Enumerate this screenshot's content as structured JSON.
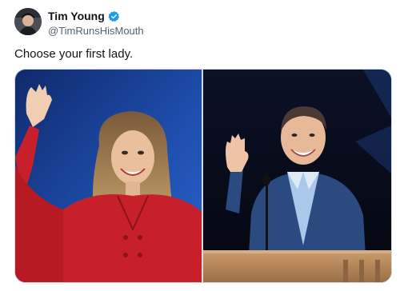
{
  "user": {
    "display_name": "Tim Young",
    "handle": "@TimRunsHisMouth",
    "verified": true,
    "avatar_icon": "avatar-photo"
  },
  "tweet": {
    "text": "Choose your first lady."
  },
  "media": {
    "photos": [
      {
        "name": "photo-left",
        "icon": "woman-in-red-waving"
      },
      {
        "name": "photo-right",
        "icon": "man-at-podium-waving"
      }
    ]
  },
  "colors": {
    "verified_badge": "#1d9bf0",
    "handle": "#536471",
    "text": "#0f1419",
    "red_outfit": "#c8202a",
    "blue_background": "#1f4fb0",
    "podium": "#b98a5e"
  }
}
